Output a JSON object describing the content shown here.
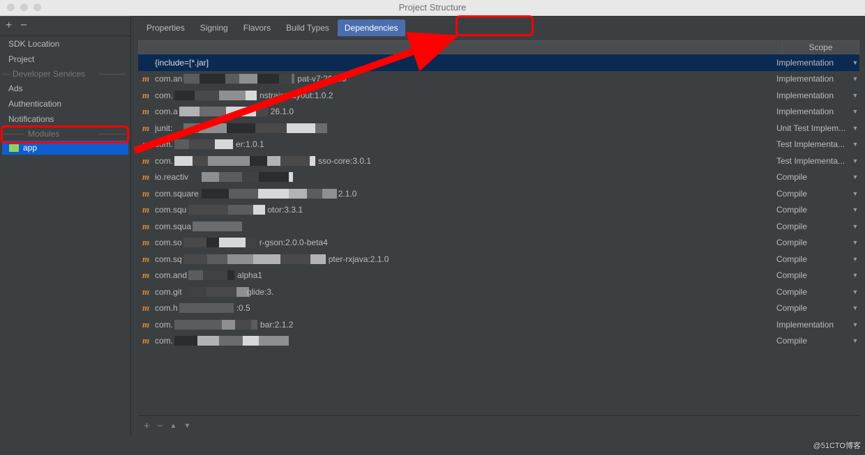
{
  "window": {
    "title": "Project Structure"
  },
  "sidebar": {
    "items": [
      {
        "label": "SDK Location",
        "indent": "item"
      },
      {
        "label": "Project",
        "indent": "item"
      },
      {
        "label": "Developer Services",
        "indent": "subhdr"
      },
      {
        "label": "Ads",
        "indent": "item"
      },
      {
        "label": "Authentication",
        "indent": "item"
      },
      {
        "label": "Notifications",
        "indent": "item"
      },
      {
        "label": "Modules",
        "indent": "modhdr"
      }
    ],
    "app_label": "app"
  },
  "tabs": [
    {
      "label": "Properties",
      "active": false
    },
    {
      "label": "Signing",
      "active": false
    },
    {
      "label": "Flavors",
      "active": false
    },
    {
      "label": "Build Types",
      "active": false
    },
    {
      "label": "Dependencies",
      "active": true
    }
  ],
  "deps_header": {
    "scope": "Scope"
  },
  "deps": [
    {
      "icon": "",
      "sel": true,
      "pre": "{include=[*.jar]",
      "post": "",
      "scope": "Implementation"
    },
    {
      "icon": "m",
      "pre": "com.an",
      "post": "pat-v7:26.1.0",
      "scope": "Implementation"
    },
    {
      "icon": "m",
      "pre": "com.",
      "post": "nstraint-layout:1.0.2",
      "scope": "Implementation"
    },
    {
      "icon": "m",
      "pre": "com.a",
      "post": "26.1.0",
      "scope": "Implementation"
    },
    {
      "icon": "m",
      "pre": "junit:",
      "post": "",
      "scope": "Unit Test Implem..."
    },
    {
      "icon": "m",
      "pre": "com.",
      "post": "er:1.0.1",
      "scope": "Test Implementa..."
    },
    {
      "icon": "m",
      "pre": "com.",
      "post": "sso-core:3.0.1",
      "scope": "Test Implementa..."
    },
    {
      "icon": "m",
      "pre": "io.reactiv",
      "post": "",
      "scope": "Compile"
    },
    {
      "icon": "m",
      "pre": "com.square",
      "post": "2.1.0",
      "scope": "Compile"
    },
    {
      "icon": "m",
      "pre": "com.squ",
      "post": "otor:3.3.1",
      "scope": "Compile"
    },
    {
      "icon": "m",
      "pre": "com.squa",
      "post": "",
      "scope": "Compile"
    },
    {
      "icon": "m",
      "pre": "com.so",
      "post": "r-gson:2.0.0-beta4",
      "scope": "Compile"
    },
    {
      "icon": "m",
      "pre": "com.sq",
      "post": "pter-rxjava:2.1.0",
      "scope": "Compile"
    },
    {
      "icon": "m",
      "pre": "com.and",
      "post": "alpha1",
      "scope": "Compile"
    },
    {
      "icon": "m",
      "pre": "com.git",
      "post": "glide:3.",
      "scope": "Compile"
    },
    {
      "icon": "m",
      "pre": "com.h",
      "post": ":0.5",
      "scope": "Compile"
    },
    {
      "icon": "m",
      "pre": "com.",
      "post": "bar:2.1.2",
      "scope": "Implementation"
    },
    {
      "icon": "m",
      "pre": "com.",
      "post": "",
      "scope": "Compile"
    }
  ],
  "watermark": "@51CTO博客"
}
